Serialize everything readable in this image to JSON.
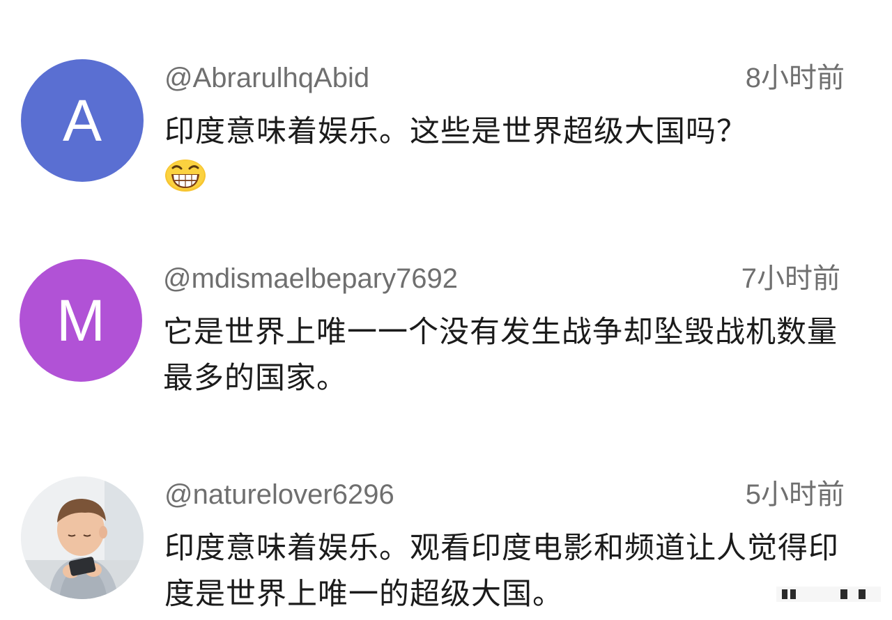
{
  "colors": {
    "avatar_a": "#5a6fd2",
    "avatar_m": "#b152d6",
    "username": "#6f6f6f",
    "text": "#1b1b1b"
  },
  "comments": [
    {
      "avatar_letter": "A",
      "username": "@Abrarulhq​Abid",
      "time": "8小时前",
      "text": "印度意味着娱乐。这些是世界超级大国吗？",
      "emoji": "grinning-squinting-face"
    },
    {
      "avatar_letter": "M",
      "username": "@mdismaelbepary7692",
      "time": "7小时前",
      "text": "它是世界上唯一一个没有发生战争却坠毁战机数量最多的国家。"
    },
    {
      "avatar_image": "child-photo",
      "username": "@naturelover6296",
      "time": "5小时前",
      "text": "印度意味着娱乐。观看印度电影和频道让人觉得印度是世界上唯一的超级大国。"
    }
  ]
}
